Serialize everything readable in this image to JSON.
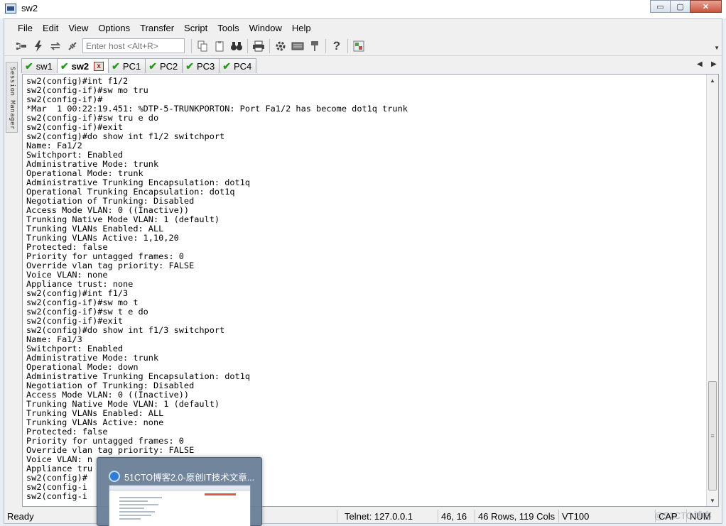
{
  "window": {
    "title": "sw2",
    "minimize_glyph": "▭",
    "maximize_glyph": "▢",
    "close_glyph": "✕"
  },
  "menu": [
    "File",
    "Edit",
    "View",
    "Options",
    "Transfer",
    "Script",
    "Tools",
    "Window",
    "Help"
  ],
  "toolbar": {
    "host_placeholder": "Enter host <Alt+R>",
    "icons": [
      "connect-icon",
      "quick-connect-icon",
      "reconnect-icon",
      "disconnect-icon",
      "copy-icon",
      "paste-icon",
      "find-icon",
      "print-icon",
      "settings-icon",
      "keymap-icon",
      "lock-icon",
      "help-icon",
      "sftp-icon"
    ],
    "help_glyph": "?"
  },
  "session_manager": {
    "label": "Session Manager"
  },
  "tabs": [
    {
      "label": "sw1",
      "status": "connected",
      "active": false
    },
    {
      "label": "sw2",
      "status": "connected",
      "active": true,
      "close_glyph": "x"
    },
    {
      "label": "PC1",
      "status": "connected",
      "active": false
    },
    {
      "label": "PC2",
      "status": "connected",
      "active": false
    },
    {
      "label": "PC3",
      "status": "connected",
      "active": false
    },
    {
      "label": "PC4",
      "status": "connected",
      "active": false
    }
  ],
  "terminal": {
    "lines": [
      "sw2(config)#int f1/2",
      "sw2(config-if)#sw mo tru",
      "sw2(config-if)#",
      "*Mar  1 00:22:19.451: %DTP-5-TRUNKPORTON: Port Fa1/2 has become dot1q trunk",
      "sw2(config-if)#sw tru e do",
      "sw2(config-if)#exit",
      "sw2(config)#do show int f1/2 switchport",
      "Name: Fa1/2",
      "Switchport: Enabled",
      "Administrative Mode: trunk",
      "Operational Mode: trunk",
      "Administrative Trunking Encapsulation: dot1q",
      "Operational Trunking Encapsulation: dot1q",
      "Negotiation of Trunking: Disabled",
      "Access Mode VLAN: 0 ((Inactive))",
      "Trunking Native Mode VLAN: 1 (default)",
      "Trunking VLANs Enabled: ALL",
      "Trunking VLANs Active: 1,10,20",
      "Protected: false",
      "Priority for untagged frames: 0",
      "Override vlan tag priority: FALSE",
      "Voice VLAN: none",
      "Appliance trust: none",
      "sw2(config)#int f1/3",
      "sw2(config-if)#sw mo t",
      "sw2(config-if)#sw t e do",
      "sw2(config-if)#exit",
      "sw2(config)#do show int f1/3 switchport",
      "Name: Fa1/3",
      "Switchport: Enabled",
      "Administrative Mode: trunk",
      "Operational Mode: down",
      "Administrative Trunking Encapsulation: dot1q",
      "Negotiation of Trunking: Disabled",
      "Access Mode VLAN: 0 ((Inactive))",
      "Trunking Native Mode VLAN: 1 (default)",
      "Trunking VLANs Enabled: ALL",
      "Trunking VLANs Active: none",
      "Protected: false",
      "Priority for untagged frames: 0",
      "Override vlan tag priority: FALSE",
      "Voice VLAN: n",
      "Appliance tru",
      "sw2(config)#",
      "sw2(config-i",
      "sw2(config-i"
    ]
  },
  "status_bar": {
    "state": "Ready",
    "connection": "Telnet: 127.0.0.1",
    "cursor": "46,  16",
    "size": "46 Rows, 119 Cols",
    "emulation": "VT100",
    "caps": "CAP",
    "numlock": "NUM"
  },
  "taskbar_preview": {
    "title": "51CTO博客2.0-原创IT技术文章..."
  },
  "watermark": "@51CTO博客",
  "colors": {
    "check_green": "#1e9d18",
    "terminal_bg": "#ffffff",
    "chrome_bg": "#f0f0f0"
  }
}
